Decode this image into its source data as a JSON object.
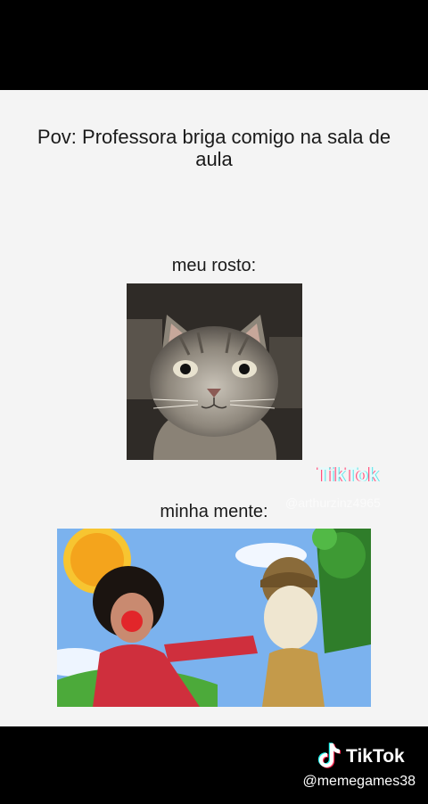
{
  "meme": {
    "title": "Pov: Professora briga comigo na sala de aula",
    "caption_face": "meu rosto:",
    "caption_mind": "minha mente:",
    "photo_face_subject": "cat-face-photo",
    "photo_mind_subject": "clown-scene-photo"
  },
  "overlay": {
    "watermark_logo": "TikTok",
    "watermark_user": "@arthurzinz4965"
  },
  "brand": {
    "logo_label": "TikTok",
    "username": "@memegames38",
    "icon": "tiktok-note-icon"
  },
  "colors": {
    "background": "#f4f4f4",
    "bars": "#000000",
    "text": "#1a1a1a"
  }
}
